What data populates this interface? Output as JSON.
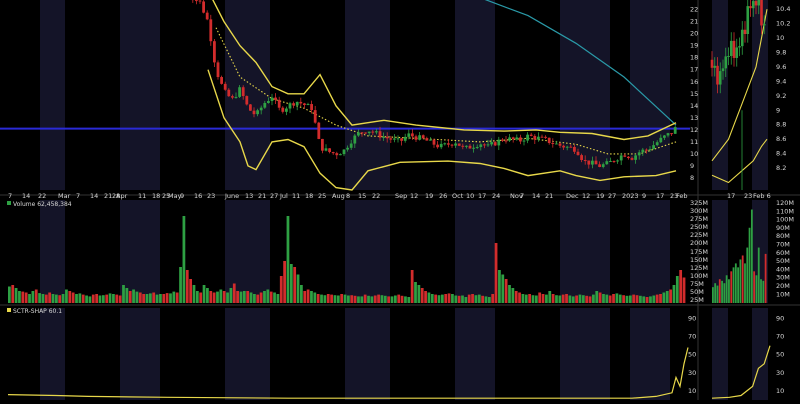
{
  "chart_data": [
    {
      "type": "candlestick",
      "panel": "main-price",
      "reference_line": 12.1,
      "ylim": [
        7,
        22.8
      ],
      "y_ticks": [
        22,
        21,
        20,
        19,
        18,
        17,
        16,
        15,
        14,
        13,
        12,
        11,
        10,
        9,
        8
      ],
      "x_tick_labels": [
        "7",
        "14",
        "22",
        "Mar",
        "7",
        "14",
        "21",
        "28",
        "Apr",
        "11",
        "18",
        "25",
        "May",
        "9",
        "16",
        "23",
        "June",
        "13",
        "21",
        "27",
        "Jul",
        "11",
        "18",
        "25",
        "Aug",
        "8",
        "15",
        "22",
        "Sep",
        "12",
        "19",
        "26",
        "Oct",
        "10",
        "17",
        "24",
        "Nov",
        "7",
        "14",
        "21",
        "Dec",
        "12",
        "19",
        "27",
        "2023",
        "9",
        "17",
        "23",
        "Feb"
      ],
      "close_trend": [
        [
          0.23,
          23.5
        ],
        [
          0.25,
          22.6
        ],
        [
          0.26,
          21.0
        ],
        [
          0.27,
          17.0
        ],
        [
          0.28,
          15.2
        ],
        [
          0.29,
          14.5
        ],
        [
          0.3,
          15.4
        ],
        [
          0.31,
          13.8
        ],
        [
          0.32,
          13.2
        ],
        [
          0.33,
          14.2
        ],
        [
          0.34,
          14.8
        ],
        [
          0.35,
          13.6
        ],
        [
          0.37,
          14.4
        ],
        [
          0.39,
          13.8
        ],
        [
          0.4,
          10.6
        ],
        [
          0.41,
          10.2
        ],
        [
          0.42,
          10.0
        ],
        [
          0.43,
          10.3
        ],
        [
          0.44,
          11.2
        ],
        [
          0.45,
          11.8
        ],
        [
          0.46,
          12.0
        ],
        [
          0.48,
          11.4
        ],
        [
          0.5,
          11.0
        ],
        [
          0.51,
          11.6
        ],
        [
          0.53,
          11.2
        ],
        [
          0.55,
          10.6
        ],
        [
          0.57,
          11.0
        ],
        [
          0.58,
          10.4
        ],
        [
          0.6,
          10.9
        ],
        [
          0.61,
          10.6
        ],
        [
          0.63,
          11.3
        ],
        [
          0.65,
          11.1
        ],
        [
          0.66,
          11.5
        ],
        [
          0.68,
          11.2
        ],
        [
          0.7,
          10.7
        ],
        [
          0.72,
          10.4
        ],
        [
          0.73,
          9.4
        ],
        [
          0.75,
          9.0
        ],
        [
          0.76,
          9.2
        ],
        [
          0.77,
          9.6
        ],
        [
          0.78,
          10.0
        ],
        [
          0.79,
          9.7
        ],
        [
          0.8,
          10.2
        ],
        [
          0.81,
          10.4
        ],
        [
          0.82,
          10.9
        ],
        [
          0.83,
          11.4
        ],
        [
          0.84,
          11.8
        ],
        [
          0.845,
          12.2
        ]
      ],
      "ma_long": [
        [
          0.6,
          23.0
        ],
        [
          0.66,
          21.5
        ],
        [
          0.72,
          19.2
        ],
        [
          0.78,
          16.4
        ],
        [
          0.845,
          12.4
        ]
      ],
      "ma_short": [
        [
          0.27,
          20.5
        ],
        [
          0.3,
          16.4
        ],
        [
          0.34,
          14.6
        ],
        [
          0.38,
          13.8
        ],
        [
          0.42,
          12.4
        ],
        [
          0.46,
          11.5
        ],
        [
          0.52,
          11.3
        ],
        [
          0.6,
          11.0
        ],
        [
          0.66,
          11.3
        ],
        [
          0.72,
          10.8
        ],
        [
          0.76,
          10.0
        ],
        [
          0.8,
          10.0
        ],
        [
          0.845,
          11.0
        ]
      ],
      "bb_upper": [
        [
          0.23,
          24.0
        ],
        [
          0.26,
          23.6
        ],
        [
          0.28,
          21.0
        ],
        [
          0.3,
          19.0
        ],
        [
          0.32,
          17.6
        ],
        [
          0.34,
          15.6
        ],
        [
          0.36,
          15.0
        ],
        [
          0.38,
          15.0
        ],
        [
          0.4,
          16.6
        ],
        [
          0.42,
          14.0
        ],
        [
          0.44,
          12.4
        ],
        [
          0.48,
          12.8
        ],
        [
          0.52,
          12.4
        ],
        [
          0.58,
          12.0
        ],
        [
          0.63,
          11.9
        ],
        [
          0.67,
          12.0
        ],
        [
          0.7,
          11.8
        ],
        [
          0.74,
          11.7
        ],
        [
          0.78,
          11.2
        ],
        [
          0.81,
          11.5
        ],
        [
          0.845,
          12.6
        ]
      ],
      "bb_lower": [
        [
          0.26,
          17.0
        ],
        [
          0.28,
          13.0
        ],
        [
          0.3,
          11.0
        ],
        [
          0.31,
          9.0
        ],
        [
          0.32,
          8.7
        ],
        [
          0.34,
          11.0
        ],
        [
          0.36,
          11.2
        ],
        [
          0.38,
          10.6
        ],
        [
          0.4,
          8.4
        ],
        [
          0.42,
          7.2
        ],
        [
          0.44,
          7.0
        ],
        [
          0.46,
          8.6
        ],
        [
          0.5,
          9.3
        ],
        [
          0.56,
          9.4
        ],
        [
          0.6,
          9.2
        ],
        [
          0.63,
          8.8
        ],
        [
          0.66,
          8.2
        ],
        [
          0.7,
          8.6
        ],
        [
          0.72,
          8.2
        ],
        [
          0.75,
          7.8
        ],
        [
          0.78,
          8.1
        ],
        [
          0.82,
          8.2
        ],
        [
          0.845,
          8.6
        ]
      ]
    },
    {
      "type": "line",
      "panel": "inset-price",
      "ylim": [
        8.0,
        10.5
      ],
      "y_ticks": [
        10.4,
        10.2,
        10.0,
        9.8,
        9.6,
        9.4,
        9.2,
        9.0,
        8.8,
        8.6,
        8.4,
        8.2
      ],
      "x_tick_labels": [
        "17",
        "23",
        "Feb 6"
      ],
      "close_trend": [
        [
          0.0,
          9.7
        ],
        [
          0.15,
          9.4
        ],
        [
          0.3,
          9.8
        ],
        [
          0.5,
          10.0
        ],
        [
          0.65,
          10.3
        ],
        [
          0.8,
          10.5
        ],
        [
          1.0,
          10.2
        ]
      ],
      "ma_short": [
        [
          0.0,
          8.3
        ],
        [
          0.3,
          8.6
        ],
        [
          0.6,
          9.2
        ],
        [
          0.8,
          9.6
        ],
        [
          1.0,
          10.4
        ]
      ],
      "lower_band": [
        [
          0.0,
          8.1
        ],
        [
          0.3,
          8.0
        ],
        [
          0.6,
          8.2
        ],
        [
          0.75,
          8.3
        ],
        [
          0.9,
          8.5
        ],
        [
          1.0,
          8.6
        ]
      ]
    },
    {
      "type": "bar",
      "panel": "volume",
      "legend": "Volume 62,458,384",
      "y_ticks": [
        "325M",
        "300M",
        "275M",
        "250M",
        "225M",
        "200M",
        "175M",
        "150M",
        "125M",
        "100M",
        "75M",
        "50M",
        "25M"
      ],
      "ylim": [
        0,
        330
      ],
      "values_M": [
        55,
        60,
        50,
        40,
        38,
        35,
        30,
        40,
        45,
        33,
        30,
        28,
        35,
        30,
        28,
        26,
        30,
        45,
        40,
        35,
        30,
        32,
        28,
        25,
        22,
        28,
        30,
        25,
        26,
        28,
        32,
        30,
        28,
        25,
        60,
        50,
        40,
        45,
        38,
        35,
        30,
        30,
        32,
        35,
        28,
        30,
        30,
        33,
        32,
        38,
        35,
        120,
        290,
        110,
        80,
        60,
        40,
        35,
        60,
        50,
        40,
        35,
        38,
        45,
        40,
        35,
        50,
        65,
        40,
        38,
        40,
        40,
        35,
        30,
        28,
        35,
        40,
        45,
        38,
        35,
        30,
        90,
        140,
        290,
        130,
        120,
        95,
        60,
        40,
        45,
        40,
        35,
        30,
        28,
        26,
        30,
        28,
        26,
        25,
        30,
        28,
        25,
        26,
        24,
        22,
        22,
        28,
        24,
        22,
        25,
        28,
        26,
        24,
        22,
        22,
        25,
        28,
        24,
        22,
        20,
        110,
        70,
        60,
        50,
        40,
        35,
        30,
        28,
        26,
        28,
        30,
        32,
        30,
        25,
        24,
        25,
        20,
        28,
        30,
        26,
        28,
        24,
        22,
        20,
        30,
        200,
        110,
        95,
        80,
        60,
        50,
        40,
        35,
        30,
        28,
        30,
        26,
        25,
        35,
        30,
        28,
        40,
        30,
        26,
        25,
        28,
        30,
        25,
        22,
        25,
        28,
        26,
        24,
        22,
        28,
        40,
        35,
        30,
        28,
        25,
        30,
        32,
        28,
        26,
        24,
        25,
        28,
        26,
        24,
        22,
        20,
        22,
        25,
        28,
        30,
        35,
        40,
        45,
        60,
        90,
        110,
        85
      ],
      "colors": "alternating green/red by day"
    },
    {
      "type": "bar",
      "panel": "inset-volume",
      "y_ticks": [
        "120M",
        "110M",
        "100M",
        "90M",
        "80M",
        "70M",
        "60M",
        "50M",
        "40M",
        "30M",
        "20M",
        "10M"
      ],
      "ylim": [
        0,
        125
      ],
      "values_M": [
        20,
        25,
        22,
        30,
        28,
        25,
        35,
        30,
        40,
        45,
        50,
        45,
        55,
        60,
        50,
        70,
        95,
        118,
        40,
        35,
        70,
        30,
        28,
        62
      ]
    },
    {
      "type": "line",
      "panel": "sctr",
      "legend": "SCTR-SHAP 60.1",
      "y_ticks": [
        "90",
        "70",
        "50",
        "30",
        "10"
      ],
      "ylim": [
        0,
        95
      ],
      "values": [
        [
          0.0,
          6
        ],
        [
          0.06,
          5
        ],
        [
          0.1,
          4
        ],
        [
          0.2,
          3
        ],
        [
          0.35,
          2
        ],
        [
          0.5,
          2
        ],
        [
          0.7,
          2
        ],
        [
          0.78,
          2
        ],
        [
          0.81,
          4
        ],
        [
          0.83,
          8
        ],
        [
          0.835,
          25
        ],
        [
          0.84,
          15
        ],
        [
          0.845,
          40
        ],
        [
          0.85,
          58
        ]
      ]
    },
    {
      "type": "line",
      "panel": "inset-sctr",
      "y_ticks": [
        "90",
        "70",
        "50",
        "30",
        "10"
      ],
      "ylim": [
        0,
        95
      ],
      "values": [
        [
          0.0,
          2
        ],
        [
          0.3,
          3
        ],
        [
          0.5,
          5
        ],
        [
          0.7,
          15
        ],
        [
          0.8,
          35
        ],
        [
          0.9,
          40
        ],
        [
          1.0,
          60
        ]
      ]
    }
  ],
  "colors": {
    "up": "#2ea043",
    "down": "#d22c2c",
    "band": "#e8d84a",
    "ma_long": "#2a9aa8",
    "reference": "#2a2ad6",
    "shade": "#141428"
  }
}
